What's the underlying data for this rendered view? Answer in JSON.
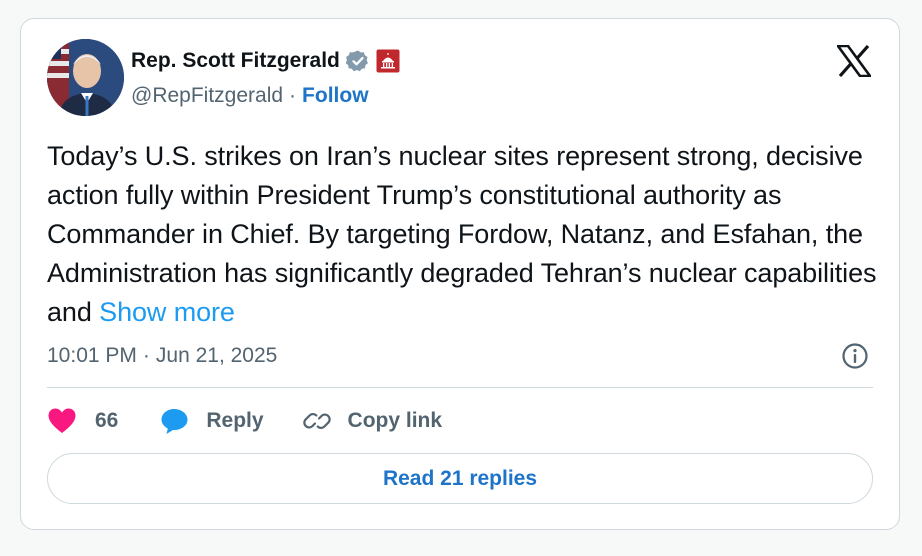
{
  "author": {
    "name": "Rep. Scott Fitzgerald",
    "handle": "@RepFitzgerald",
    "separator": "·",
    "follow_label": "Follow"
  },
  "tweet": {
    "text": "Today’s U.S. strikes on Iran’s nuclear sites represent strong, decisive action fully within President Trump’s constitutional authority as Commander in Chief. By targeting Fordow, Natanz, and Esfahan, the Administration has significantly degraded Tehran’s nuclear capabilities and",
    "show_more_label": "Show more",
    "time": "10:01 PM",
    "date_separator": "·",
    "date": "Jun 21, 2025"
  },
  "actions": {
    "like_count": "66",
    "reply_label": "Reply",
    "copy_link_label": "Copy link"
  },
  "read_replies_label": "Read 21 replies",
  "icons": {
    "verified": "verified-badge-icon",
    "affiliation": "capitol-affiliation-icon",
    "brand": "x-logo-icon",
    "info": "info-icon",
    "like": "heart-icon",
    "reply": "reply-bubble-icon",
    "copy": "link-icon"
  },
  "colors": {
    "link_blue": "#1d9bf0",
    "follow_blue": "#1d74c9",
    "heart_pink": "#f91880",
    "secondary_text": "#536471",
    "border": "#cfd9de"
  }
}
